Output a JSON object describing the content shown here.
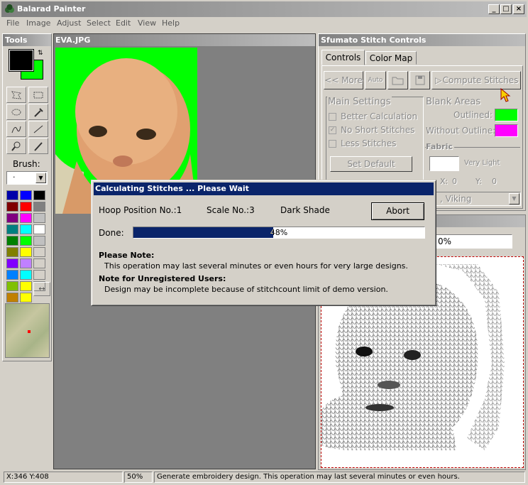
{
  "window": {
    "title": "Balarad Painter"
  },
  "menu": [
    "File",
    "Image",
    "Adjust",
    "Select",
    "Edit",
    "View",
    "Help"
  ],
  "tools": {
    "title": "Tools",
    "brush_label": "Brush:",
    "brush_value": "·",
    "palette": [
      "#0000aa",
      "#0000ff",
      "#000000",
      "#800000",
      "#ff0000",
      "#808080",
      "#800080",
      "#ff00ff",
      "#c0c0c0",
      "#008080",
      "#00ffff",
      "#ffffff",
      "#008000",
      "#00ff00",
      "#c0c0c0",
      "#808000",
      "#ffff00",
      "#d4d0c8",
      "#8000ff",
      "#c080ff",
      "#d4d0c8",
      "#0080ff",
      "#00ffff",
      "#d4d0c8",
      "#80c000",
      "#ffff00",
      "#d4d0c8",
      "#c08000",
      "#ffff00"
    ],
    "foreground": "#000000",
    "background": "#00ff00"
  },
  "document": {
    "title": "EVA.JPG"
  },
  "sfumato": {
    "title": "Sfumato Stitch Controls",
    "tabs": [
      "Controls",
      "Color Map"
    ],
    "more_label": "<< More",
    "auto_label": "Auto",
    "compute_label": "Compute Stitches",
    "main_settings": "Main Settings",
    "options": [
      {
        "label": "Better Calculation",
        "checked": false
      },
      {
        "label": "No Short Stitches",
        "checked": true
      },
      {
        "label": "Less Stitches",
        "checked": false
      }
    ],
    "set_default": "Set Default",
    "blank_areas": "Blank Areas",
    "outlined": "Outlined:",
    "without_outline": "Without Outline:",
    "outlined_color": "#00ff00",
    "without_color": "#ff00ff",
    "fabric": "Fabric",
    "fabric_value": "Very Light",
    "x_label": "X:",
    "x_value": "0",
    "y_label": "Y:",
    "y_value": "0",
    "machine_value": ", Viking"
  },
  "preview": {
    "zoom_value": "0%"
  },
  "dialog": {
    "title": "Calculating Stitches ... Please Wait",
    "hoop": "Hoop Position No.:1",
    "scale": "Scale No.:3",
    "shade": "Dark Shade",
    "abort": "Abort",
    "done_label": "Done:",
    "progress": 48,
    "progress_text": "48%",
    "note1_title": "Please Note:",
    "note1_text": "This operation may last several minutes or even hours for very large designs.",
    "note2_title": "Note for Unregistered Users:",
    "note2_text": "Design may be incomplete because of stitchcount limit of demo version."
  },
  "status": {
    "coords": "X:346  Y:408",
    "zoom": "50%",
    "message": "Generate embroidery design. This operation may last several minutes or even hours."
  }
}
